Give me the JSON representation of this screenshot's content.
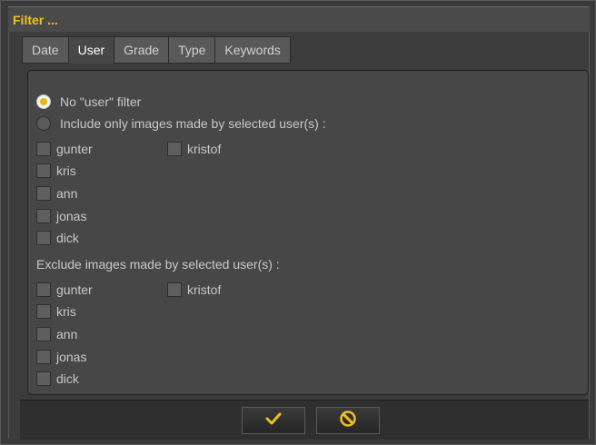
{
  "window": {
    "title": "Filter ..."
  },
  "tabs": [
    {
      "label": "Date",
      "active": false
    },
    {
      "label": "User",
      "active": true
    },
    {
      "label": "Grade",
      "active": false
    },
    {
      "label": "Type",
      "active": false
    },
    {
      "label": "Keywords",
      "active": false
    }
  ],
  "user_filter": {
    "no_filter_label": "No \"user\" filter",
    "include_label": "Include only images made by selected user(s) :",
    "include_users": [
      "gunter",
      "kris",
      "ann",
      "jonas",
      "dick",
      "kristof"
    ],
    "exclude_label": "Exclude images made by selected user(s) :",
    "exclude_users": [
      "gunter",
      "kris",
      "ann",
      "jonas",
      "dick",
      "kristof"
    ]
  },
  "buttons": {
    "ok_icon": "checkmark-icon",
    "cancel_icon": "cancel-icon"
  },
  "colors": {
    "accent": "#f0c020",
    "background": "#3a3a3a",
    "panel": "#474747"
  }
}
